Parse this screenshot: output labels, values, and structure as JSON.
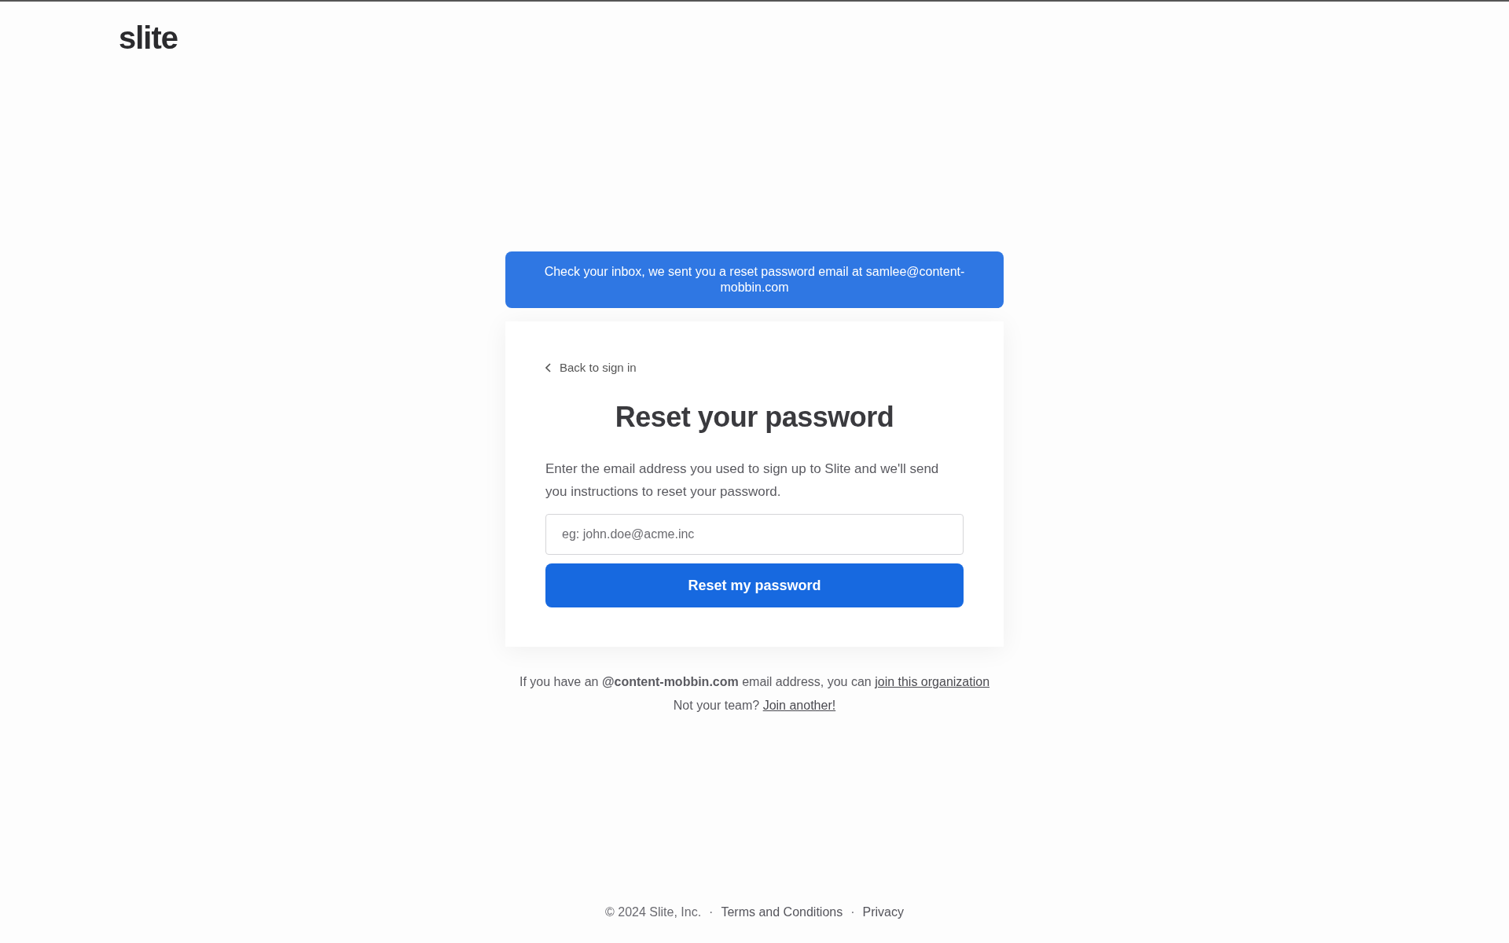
{
  "logo": "slite",
  "banner": "Check your inbox, we sent you a reset password email at samlee@content-mobbin.com",
  "card": {
    "back_link": "Back to sign in",
    "title": "Reset your password",
    "description": "Enter the email address you used to sign up to Slite and we'll send you instructions to reset your password.",
    "email_field": {
      "placeholder": "eg: john.doe@acme.inc"
    },
    "submit_button": "Reset my password"
  },
  "join_note": {
    "text": "If you have an **@content-mobbin.com** email address, you can",
    "link": "join this organization"
  },
  "other_team": {
    "text": "Not your team?",
    "link": "Join another!"
  },
  "footer": [
    {
      "kind": "text",
      "label": "© 2024 Slite, Inc."
    },
    {
      "kind": "separator",
      "label": "·"
    },
    {
      "kind": "link",
      "label": "Terms and Conditions"
    },
    {
      "kind": "separator",
      "label": "·"
    },
    {
      "kind": "link",
      "label": "Privacy"
    }
  ]
}
